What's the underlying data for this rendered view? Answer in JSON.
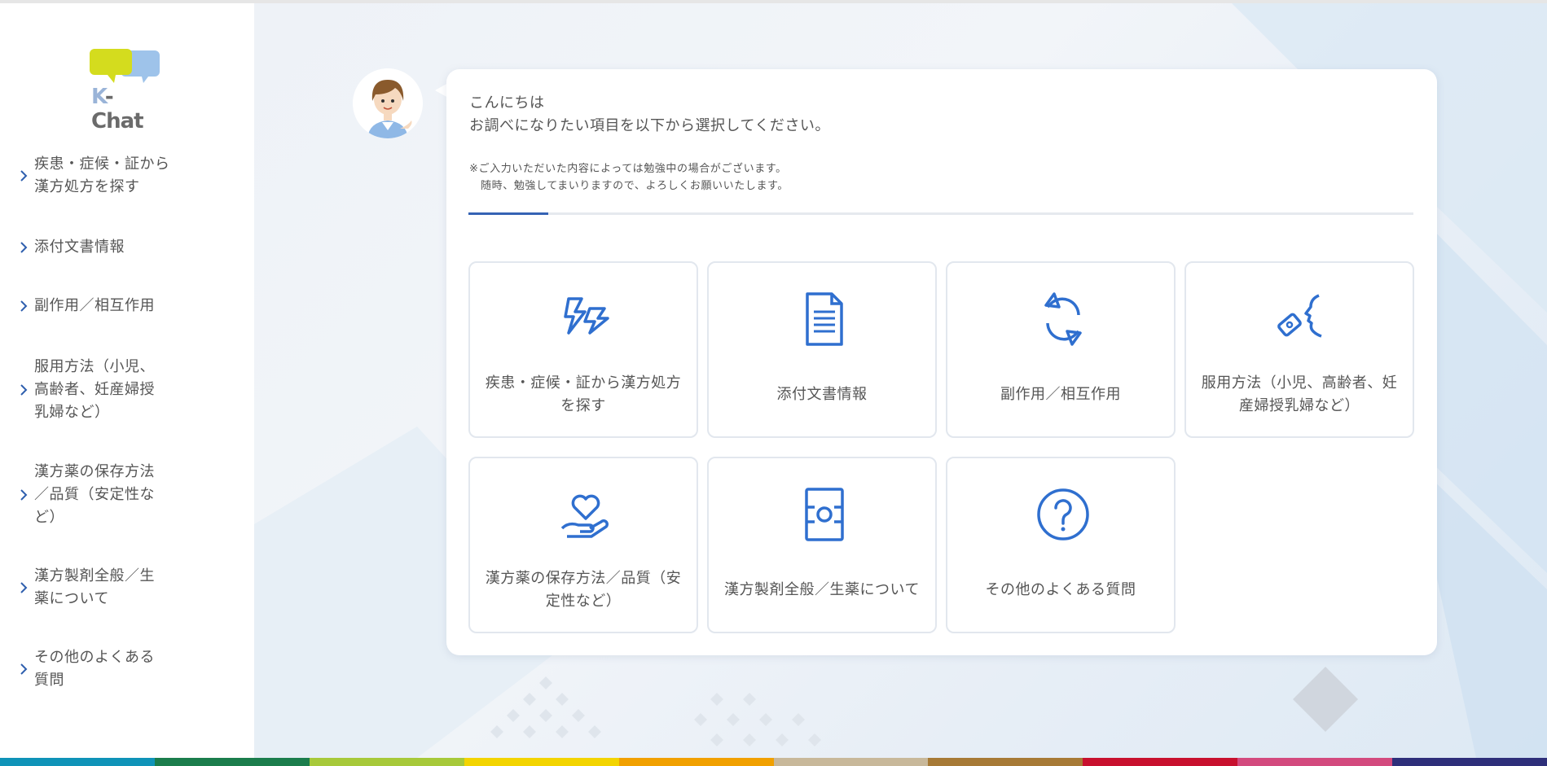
{
  "app": {
    "logo_text_k": "K",
    "logo_text_rest": "-Chat"
  },
  "sidebar": {
    "items": [
      {
        "label": "疾患・症候・証から漢方処方を探す"
      },
      {
        "label": "添付文書情報"
      },
      {
        "label": "副作用／相互作用"
      },
      {
        "label": "服用方法（小児、高齢者、妊産婦授乳婦など）"
      },
      {
        "label": "漢方薬の保存方法／品質（安定性など）"
      },
      {
        "label": "漢方製剤全般／生薬について"
      },
      {
        "label": "その他のよくある質問"
      }
    ]
  },
  "chat": {
    "greeting_line1": "こんにちは",
    "greeting_line2": "お調べになりたい項目を以下から選択してください。",
    "notice_line1": "※ご入力いただいた内容によっては勉強中の場合がございます。",
    "notice_line2": "随時、勉強してまいりますので、よろしくお願いいたします。"
  },
  "tiles": [
    {
      "label": "疾患・症候・証から漢方処方を探す",
      "icon": "lightning-icon"
    },
    {
      "label": "添付文書情報",
      "icon": "document-icon"
    },
    {
      "label": "副作用／相互作用",
      "icon": "exchange-arrows-icon"
    },
    {
      "label": "服用方法（小児、高齢者、妊産婦授乳婦など）",
      "icon": "pill-swallow-icon"
    },
    {
      "label": "漢方薬の保存方法／品質（安定性など）",
      "icon": "heart-hand-icon"
    },
    {
      "label": "漢方製剤全般／生薬について",
      "icon": "medicine-box-icon"
    },
    {
      "label": "その他のよくある質問",
      "icon": "question-icon"
    }
  ],
  "colors": {
    "accent": "#3563b4",
    "icon_blue": "#2f6fcf",
    "logo_green": "#d4dc1e",
    "logo_blue": "#9ec3ea",
    "colorbar": [
      "#0f93b8",
      "#1b7d4c",
      "#a7c93a",
      "#f3d400",
      "#f1a000",
      "#c8b89a",
      "#a77a36",
      "#c8102e",
      "#d34a7e",
      "#2e2f7a"
    ]
  }
}
